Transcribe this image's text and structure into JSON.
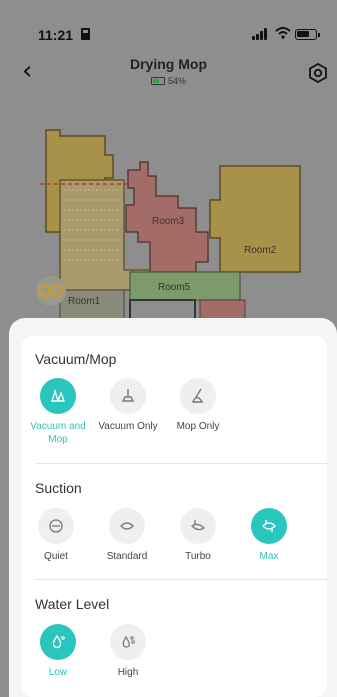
{
  "status_bar": {
    "time": "11:21"
  },
  "nav": {
    "title": "Drying Mop",
    "battery": "54%"
  },
  "map": {
    "rooms": [
      "Room3",
      "Room2",
      "Room5",
      "Room1"
    ]
  },
  "vacuum_mop": {
    "title": "Vacuum/Mop",
    "options": [
      {
        "label": "Vacuum and Mop",
        "icon": "vacuum-mop-icon",
        "active": true
      },
      {
        "label": "Vacuum Only",
        "icon": "vacuum-icon",
        "active": false
      },
      {
        "label": "Mop Only",
        "icon": "mop-icon",
        "active": false
      }
    ]
  },
  "suction": {
    "title": "Suction",
    "options": [
      {
        "label": "Quiet",
        "icon": "quiet-icon",
        "active": false
      },
      {
        "label": "Standard",
        "icon": "standard-icon",
        "active": false
      },
      {
        "label": "Turbo",
        "icon": "turbo-icon",
        "active": false
      },
      {
        "label": "Max",
        "icon": "max-icon",
        "active": true
      }
    ]
  },
  "water_level": {
    "title": "Water Level",
    "options": [
      {
        "label": "Low",
        "icon": "water-low-icon",
        "active": true
      },
      {
        "label": "High",
        "icon": "water-high-icon",
        "active": false
      }
    ]
  },
  "colors": {
    "accent": "#2ac5bd",
    "overlay": "#8e8e8e",
    "card": "#ffffff"
  }
}
